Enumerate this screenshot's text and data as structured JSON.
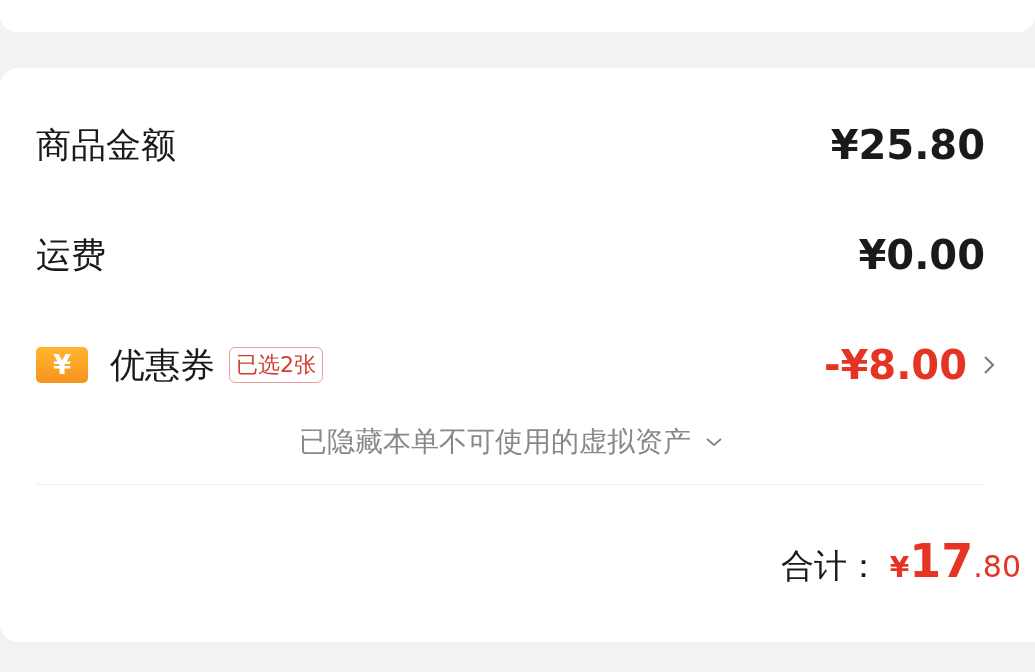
{
  "summary": {
    "rows": [
      {
        "kind": "plain",
        "label": "商品金额",
        "amount": "¥25.80"
      },
      {
        "kind": "plain",
        "label": "运费",
        "amount": "¥0.00"
      },
      {
        "kind": "coupon",
        "label": "优惠券",
        "badge": "已选2张",
        "amount": "-¥8.00",
        "icon_text": "¥"
      }
    ],
    "hidden_note": "已隐藏本单不可使用的虚拟资产",
    "total": {
      "label": "合计：",
      "currency": "¥",
      "integer": "17",
      "decimal": ".80"
    }
  }
}
